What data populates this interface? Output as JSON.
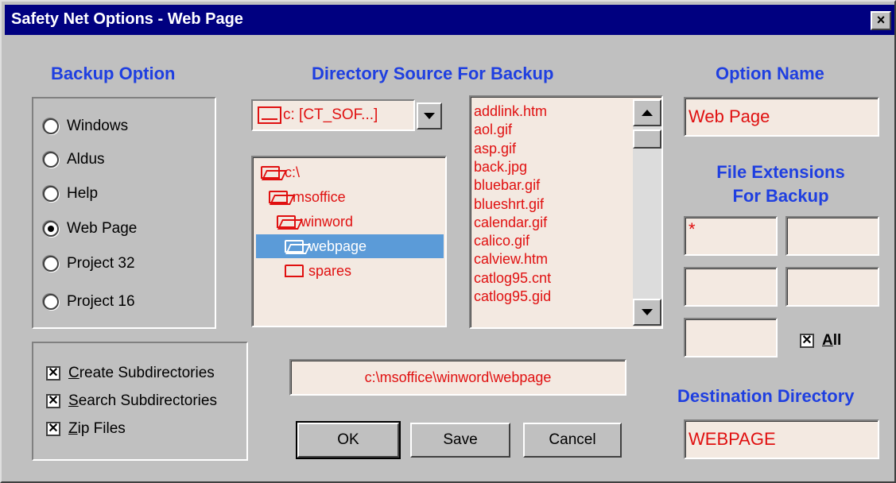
{
  "window": {
    "title": "Safety Net Options - Web Page",
    "close_glyph": "×"
  },
  "headings": {
    "backup_option": "Backup Option",
    "directory_source": "Directory Source For Backup",
    "option_name": "Option Name",
    "file_extensions_line1": "File Extensions",
    "file_extensions_line2": "For Backup",
    "destination_directory": "Destination Directory"
  },
  "backup_options": [
    {
      "label": "Windows",
      "selected": false
    },
    {
      "label": "Aldus",
      "selected": false
    },
    {
      "label": "Help",
      "selected": false
    },
    {
      "label": "Web Page",
      "selected": true
    },
    {
      "label": "Project 32",
      "selected": false
    },
    {
      "label": "Project 16",
      "selected": false
    }
  ],
  "checkboxes": [
    {
      "label": "Create Subdirectories",
      "checked": true
    },
    {
      "label": "Search Subdirectories",
      "checked": true
    },
    {
      "label": "Zip Files",
      "checked": true
    }
  ],
  "drive": {
    "value": "c: [CT_SOF...]"
  },
  "tree": [
    {
      "label": "c:\\",
      "indent": 0,
      "open": true,
      "selected": false
    },
    {
      "label": "msoffice",
      "indent": 1,
      "open": true,
      "selected": false
    },
    {
      "label": "winword",
      "indent": 2,
      "open": true,
      "selected": false
    },
    {
      "label": "webpage",
      "indent": 3,
      "open": true,
      "selected": true
    },
    {
      "label": "spares",
      "indent": 3,
      "open": false,
      "selected": false
    }
  ],
  "files": [
    "addlink.htm",
    "aol.gif",
    "asp.gif",
    "back.jpg",
    "bluebar.gif",
    "blueshrt.gif",
    "calendar.gif",
    "calico.gif",
    "calview.htm",
    "catlog95.cnt",
    "catlog95.gid"
  ],
  "current_path": "c:\\msoffice\\winword\\webpage",
  "option_name": "Web Page",
  "extensions": [
    "*",
    "",
    "",
    "",
    ""
  ],
  "all_checkbox": {
    "label": "All",
    "checked": true
  },
  "destination": "WEBPAGE",
  "buttons": {
    "ok": "OK",
    "save": "Save",
    "cancel": "Cancel"
  },
  "colors": {
    "heading": "#1f3fe0",
    "field_text": "#e01010",
    "field_bg": "#f3e9e1",
    "titlebar": "#000080",
    "selection": "#5b9bd8"
  }
}
